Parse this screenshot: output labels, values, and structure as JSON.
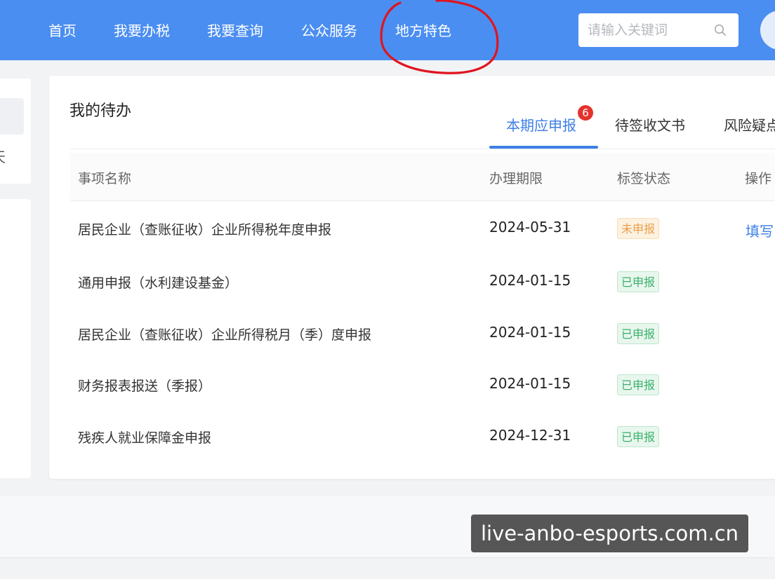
{
  "nav": {
    "items": [
      {
        "label": "首页"
      },
      {
        "label": "我要办税"
      },
      {
        "label": "我要查询"
      },
      {
        "label": "公众服务"
      },
      {
        "label": "地方特色"
      }
    ],
    "search_placeholder": "请输入关键词",
    "search_icon": "search-icon",
    "annotation_color": "#e0141e"
  },
  "sidebar": {
    "partial_text": "天"
  },
  "todo": {
    "title": "我的待办",
    "tabs": [
      {
        "label": "本期应申报",
        "badge": "6",
        "active": true
      },
      {
        "label": "待签收文书",
        "active": false
      },
      {
        "label": "风险疑点",
        "active": false
      }
    ],
    "columns": [
      "事项名称",
      "办理期限",
      "标签状态",
      "操作"
    ],
    "rows": [
      {
        "name": "居民企业（查账征收）企业所得税年度申报",
        "deadline": "2024-05-31",
        "status": "未申报",
        "action": "填写"
      },
      {
        "name": "通用申报（水利建设基金）",
        "deadline": "2024-01-15",
        "status": "已申报",
        "action": ""
      },
      {
        "name": "居民企业（查账征收）企业所得税月（季）度申报",
        "deadline": "2024-01-15",
        "status": "已申报",
        "action": ""
      },
      {
        "name": "财务报表报送（季报）",
        "deadline": "2024-01-15",
        "status": "已申报",
        "action": ""
      },
      {
        "name": "残疾人就业保障金申报",
        "deadline": "2024-12-31",
        "status": "已申报",
        "action": ""
      }
    ]
  },
  "colors": {
    "header_blue": "#4b8ef1",
    "accent_blue": "#3d7fe6",
    "badge_red": "#e5322d",
    "pending_orange": "#e8a04a",
    "done_green": "#3bb06a"
  },
  "watermark": "live-anbo-esports.com.cn"
}
